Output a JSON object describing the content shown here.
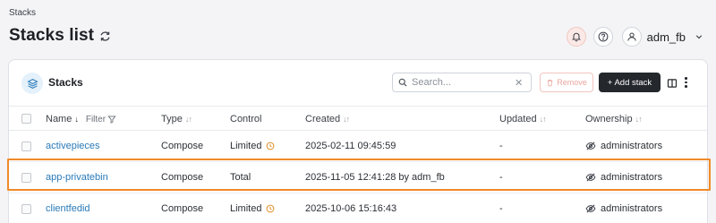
{
  "breadcrumb": "Stacks",
  "page": {
    "title": "Stacks list"
  },
  "header": {
    "user_name": "adm_fb"
  },
  "card": {
    "title": "Stacks",
    "search_placeholder": "Search...",
    "remove_label": "Remove",
    "add_label": "+ Add stack"
  },
  "columns": {
    "name": "Name",
    "filter": "Filter",
    "type": "Type",
    "control": "Control",
    "created": "Created",
    "updated": "Updated",
    "ownership": "Ownership"
  },
  "rows": [
    {
      "name": "activepieces",
      "type": "Compose",
      "control": "Limited",
      "control_warning": true,
      "created": "2025-02-11 09:45:59",
      "updated": "-",
      "ownership": "administrators"
    },
    {
      "name": "app-privatebin",
      "type": "Compose",
      "control": "Total",
      "control_warning": false,
      "created": "2025-11-05 12:41:28 by adm_fb",
      "updated": "-",
      "ownership": "administrators"
    },
    {
      "name": "clientfedid",
      "type": "Compose",
      "control": "Limited",
      "control_warning": true,
      "created": "2025-10-06 15:16:43",
      "updated": "-",
      "ownership": "administrators"
    }
  ],
  "colors": {
    "highlight": "#f08a2a",
    "link": "#2a7ab8",
    "warning": "#e0902a",
    "primary_button": "#24272c"
  },
  "icons": [
    "refresh-icon",
    "bell-icon",
    "help-icon",
    "user-icon",
    "chevron-down-icon",
    "stack-icon",
    "search-icon",
    "clear-icon",
    "trash-icon",
    "columns-icon",
    "more-icon",
    "filter-icon",
    "warning-clock-icon",
    "eye-off-icon"
  ]
}
